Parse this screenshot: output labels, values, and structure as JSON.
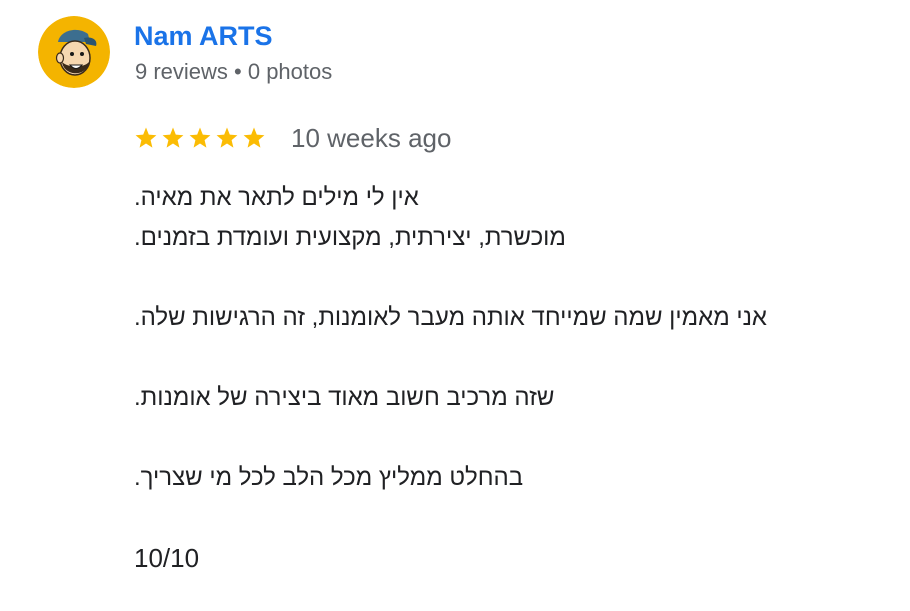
{
  "reviewer": {
    "avatar_icon": "cartoon-face-avatar",
    "name": "Nam ARTS",
    "meta": "9 reviews • 0 photos"
  },
  "rating": {
    "stars": 5,
    "max": 5,
    "star_icon": "star-icon",
    "star_color": "#fbbc04",
    "time": "10 weeks ago"
  },
  "review": {
    "lines": [
      "אין לי מילים לתאר את מאיה.",
      "מוכשרת, יצירתית, מקצועית ועומדת בזמנים.",
      "אני מאמין שמה שמייחד אותה מעבר לאומנות, זה הרגישות שלה.",
      "שזה מרכיב חשוב מאוד ביצירה של אומנות.",
      "בהחלט ממליץ מכל הלב לכל מי שצריך."
    ],
    "score": "10/10"
  },
  "colors": {
    "name": "#1a73e8",
    "meta": "#5f6368",
    "body": "#202124",
    "avatar_bg": "#f4b400"
  }
}
